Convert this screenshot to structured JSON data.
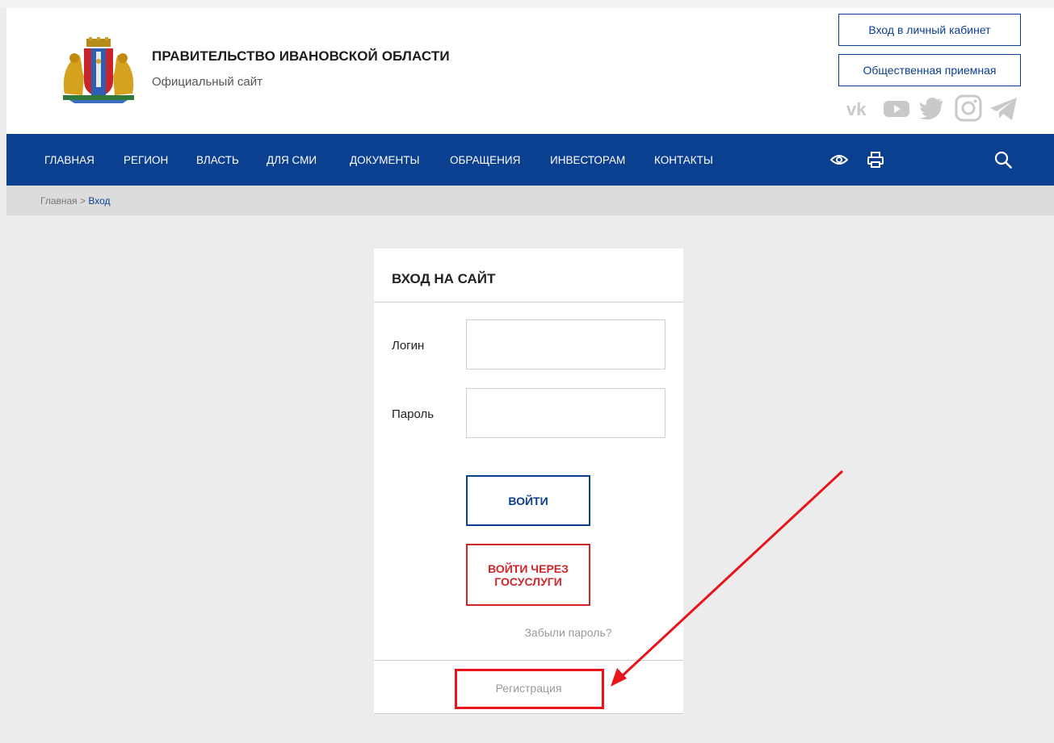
{
  "header": {
    "title": "ПРАВИТЕЛЬСТВО ИВАНОВСКОЙ ОБЛАСТИ",
    "subtitle": "Официальный сайт",
    "buttons": {
      "cabinet": "Вход в личный кабинет",
      "reception": "Общественная приемная"
    },
    "social_icons": [
      "vk-icon",
      "youtube-icon",
      "twitter-icon",
      "instagram-icon",
      "telegram-icon"
    ]
  },
  "nav": {
    "items": [
      {
        "label": "ГЛАВНАЯ"
      },
      {
        "label": "РЕГИОН"
      },
      {
        "label": "ВЛАСТЬ"
      },
      {
        "label": "ДЛЯ СМИ"
      },
      {
        "label": "ДОКУМЕНТЫ"
      },
      {
        "label": "ОБРАЩЕНИЯ"
      },
      {
        "label": "ИНВЕСТОРАМ"
      },
      {
        "label": "КОНТАКТЫ"
      }
    ],
    "icons": [
      "eye-icon",
      "print-icon",
      "search-icon"
    ]
  },
  "breadcrumb": {
    "home": "Главная",
    "separator": " > ",
    "current": "Вход"
  },
  "login_form": {
    "title": "ВХОД НА САЙТ",
    "login_label": "Логин",
    "login_value": "",
    "password_label": "Пароль",
    "password_value": "",
    "login_button": "ВОЙТИ",
    "gosuslugi_button": "ВОЙТИ ЧЕРЕЗ ГОСУСЛУГИ",
    "forgot_link": "Забыли пароль?",
    "register_link": "Регистрация"
  },
  "colors": {
    "brand": "#0b3f8f",
    "gosuslugi": "#d0262a",
    "annotation": "#e8141c",
    "background": "#ececec"
  }
}
